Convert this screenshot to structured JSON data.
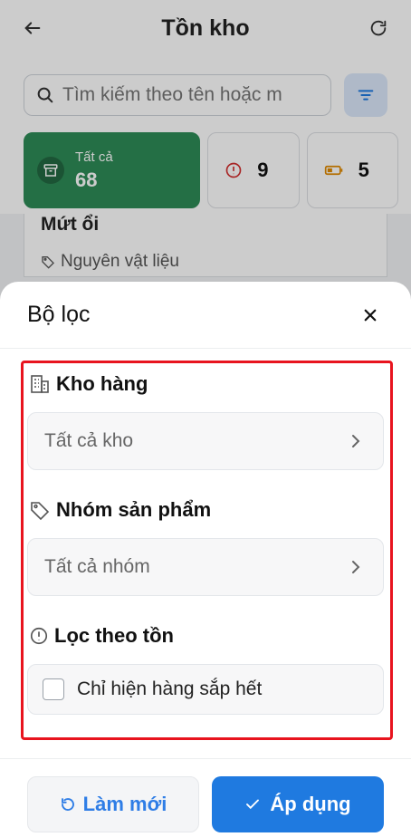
{
  "header": {
    "title": "Tồn kho"
  },
  "search": {
    "placeholder": "Tìm kiếm theo tên hoặc m"
  },
  "stats": {
    "all": {
      "label": "Tất cả",
      "count": "68"
    },
    "alert": {
      "count": "9"
    },
    "low": {
      "count": "5"
    }
  },
  "list": {
    "item_name": "Mứt ổi",
    "item_category": "Nguyên vật liệu"
  },
  "sheet": {
    "title": "Bộ lọc",
    "warehouse": {
      "label": "Kho hàng",
      "value": "Tất cả kho"
    },
    "product_group": {
      "label": "Nhóm sản phẩm",
      "value": "Tất cả nhóm"
    },
    "stock_filter": {
      "label": "Lọc theo tồn",
      "checkbox_label": "Chỉ hiện hàng sắp hết"
    },
    "reset_label": "Làm mới",
    "apply_label": "Áp dụng"
  },
  "colors": {
    "accent": "#1f7ae0",
    "green": "#2e8b57",
    "highlight": "#e8141e"
  }
}
